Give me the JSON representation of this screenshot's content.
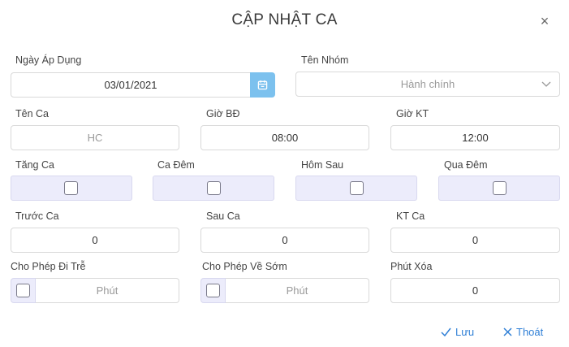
{
  "dialog": {
    "title": "CẬP NHẬT CA",
    "close_glyph": "×"
  },
  "fields": {
    "ngay_ap_dung": {
      "label": "Ngày Áp Dụng",
      "value": "03/01/2021"
    },
    "ten_nhom": {
      "label": "Tên Nhóm",
      "value": "Hành chính"
    },
    "ten_ca": {
      "label": "Tên Ca",
      "placeholder": "HC"
    },
    "gio_bd": {
      "label": "Giờ BĐ",
      "value": "08:00"
    },
    "gio_kt": {
      "label": "Giờ KT",
      "value": "12:00"
    },
    "tang_ca": {
      "label": "Tăng Ca",
      "checked": false
    },
    "ca_dem": {
      "label": "Ca Đêm",
      "checked": false
    },
    "hom_sau": {
      "label": "Hôm Sau",
      "checked": false
    },
    "qua_dem": {
      "label": "Qua Đêm",
      "checked": false
    },
    "truoc_ca": {
      "label": "Trước Ca",
      "value": "0"
    },
    "sau_ca": {
      "label": "Sau Ca",
      "value": "0"
    },
    "kt_ca": {
      "label": "KT Ca",
      "value": "0"
    },
    "cho_phep_di_tre": {
      "label": "Cho Phép Đi Trễ",
      "placeholder": "Phút",
      "checked": false
    },
    "cho_phep_ve_som": {
      "label": "Cho Phép Về Sớm",
      "placeholder": "Phút",
      "checked": false
    },
    "phut_xoa": {
      "label": "Phút Xóa",
      "value": "0"
    }
  },
  "actions": {
    "save_label": "Lưu",
    "exit_label": "Thoát"
  },
  "colors": {
    "accent": "#2f7fd6",
    "calendar_button": "#7cc1ee",
    "checkbox_bg": "#ececfb"
  },
  "icons": {
    "calendar": "calendar-icon",
    "chevron": "chevron-down-icon",
    "check": "check-icon",
    "close": "close-icon"
  }
}
